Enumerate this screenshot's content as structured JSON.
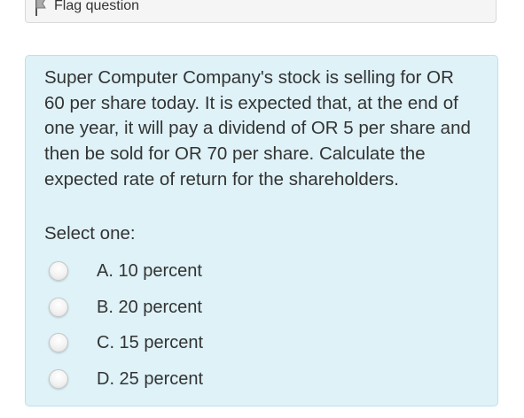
{
  "flag": {
    "label": "Flag question",
    "icon": "flag-icon"
  },
  "question": {
    "text": "Super Computer Company's stock is selling for OR 60 per share today. It is expected that, at the end of one year, it will pay a dividend of OR 5 per share and then be sold for OR 70 per share. Calculate the expected rate of return for the shareholders.",
    "prompt": "Select one:",
    "answers": [
      {
        "label": "A. 10 percent",
        "selected": false
      },
      {
        "label": "B. 20 percent",
        "selected": false
      },
      {
        "label": "C. 15 percent",
        "selected": false
      },
      {
        "label": "D. 25 percent",
        "selected": false
      }
    ]
  },
  "colors": {
    "question_bg": "#def2f8",
    "question_border": "#bfe0ec",
    "text": "#333333",
    "flag_panel_bg": "#f5f5f5"
  }
}
